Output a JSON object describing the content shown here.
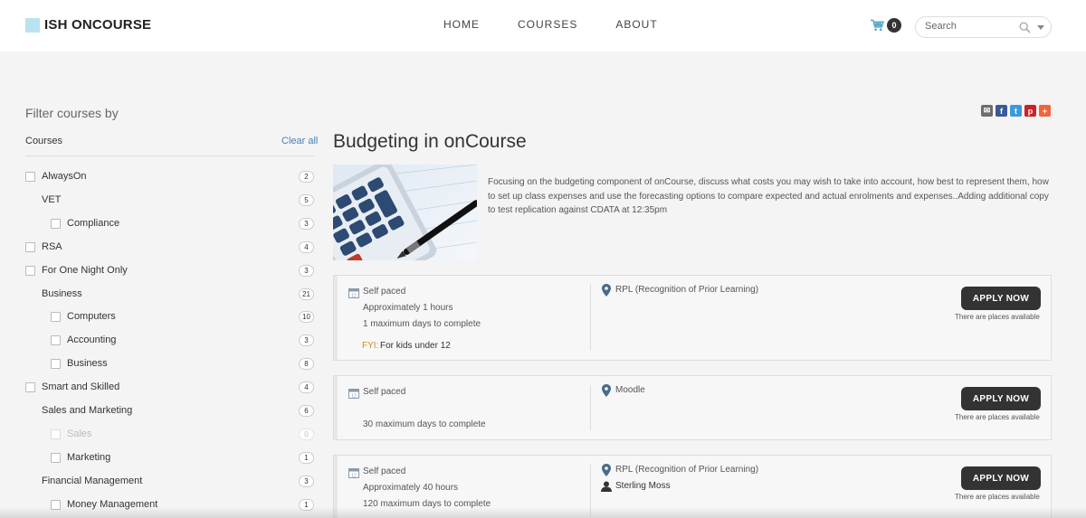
{
  "header": {
    "logo_text": "ISH ONCOURSE",
    "nav": [
      {
        "label": "HOME"
      },
      {
        "label": "COURSES"
      },
      {
        "label": "ABOUT"
      }
    ],
    "cart_count": "0",
    "search_placeholder": "Search"
  },
  "sidebar": {
    "title": "Filter courses by",
    "section_label": "Courses",
    "clear_all": "Clear all",
    "filters": [
      {
        "label": "AlwaysOn",
        "count": "2",
        "level": 0,
        "checkbox": true,
        "disabled": false
      },
      {
        "label": "VET",
        "count": "5",
        "level": 1,
        "checkbox": false,
        "disabled": false
      },
      {
        "label": "Compliance",
        "count": "3",
        "level": 2,
        "checkbox": true,
        "disabled": false
      },
      {
        "label": "RSA",
        "count": "4",
        "level": 0,
        "checkbox": true,
        "disabled": false
      },
      {
        "label": "For One Night Only",
        "count": "3",
        "level": 0,
        "checkbox": true,
        "disabled": false
      },
      {
        "label": "Business",
        "count": "21",
        "level": 1,
        "checkbox": false,
        "disabled": false
      },
      {
        "label": "Computers",
        "count": "10",
        "level": 2,
        "checkbox": true,
        "disabled": false
      },
      {
        "label": "Accounting",
        "count": "3",
        "level": 2,
        "checkbox": true,
        "disabled": false
      },
      {
        "label": "Business",
        "count": "8",
        "level": 2,
        "checkbox": true,
        "disabled": false
      },
      {
        "label": "Smart and Skilled",
        "count": "4",
        "level": 0,
        "checkbox": true,
        "disabled": false
      },
      {
        "label": "Sales and Marketing",
        "count": "6",
        "level": 1,
        "checkbox": false,
        "disabled": false
      },
      {
        "label": "Sales",
        "count": "0",
        "level": 2,
        "checkbox": true,
        "disabled": true
      },
      {
        "label": "Marketing",
        "count": "1",
        "level": 2,
        "checkbox": true,
        "disabled": false
      },
      {
        "label": "Financial Management",
        "count": "3",
        "level": 1,
        "checkbox": false,
        "disabled": false
      },
      {
        "label": "Money Management",
        "count": "1",
        "level": 2,
        "checkbox": true,
        "disabled": false
      }
    ]
  },
  "course": {
    "title": "Budgeting in onCourse",
    "description": "Focusing on the budgeting component of onCourse, discuss what costs you may wish to take into account, how best to represent them, how to set up class expenses and use the forecasting options to compare expected and actual enrolments and expenses..Adding additional copy to test replication against CDATA at 12:35pm",
    "share": [
      {
        "icon": "email-icon",
        "color": "#6d6d6d",
        "glyph": "✉"
      },
      {
        "icon": "facebook-icon",
        "color": "#3b5998",
        "glyph": "f"
      },
      {
        "icon": "twitter-icon",
        "color": "#3e9ad6",
        "glyph": "t"
      },
      {
        "icon": "pinterest-icon",
        "color": "#c92228",
        "glyph": "p"
      },
      {
        "icon": "more-icon",
        "color": "#f0653d",
        "glyph": "+"
      }
    ]
  },
  "classes": [
    {
      "schedule": "Self paced",
      "duration": "Approximately 1 hours",
      "days": "1 maximum days to complete",
      "site": "RPL (Recognition of Prior Learning)",
      "fyi_label": "FYI:",
      "fyi_text": "For kids under 12",
      "apply": "APPLY NOW",
      "availability": "There are places available"
    },
    {
      "schedule": "Self paced",
      "days": "30 maximum days to complete",
      "site": "Moodle",
      "apply": "APPLY NOW",
      "availability": "There are places available"
    },
    {
      "schedule": "Self paced",
      "duration": "Approximately 40 hours",
      "days": "120 maximum days to complete",
      "site": "RPL (Recognition of Prior Learning)",
      "tutor": "Sterling Moss",
      "apply": "APPLY NOW",
      "availability": "There are places available"
    }
  ],
  "colors": {
    "accent_link": "#4a7fb5",
    "button_dark": "#333333",
    "fyi_orange": "#d98b1f",
    "logo_square": "#b9e3f1"
  }
}
